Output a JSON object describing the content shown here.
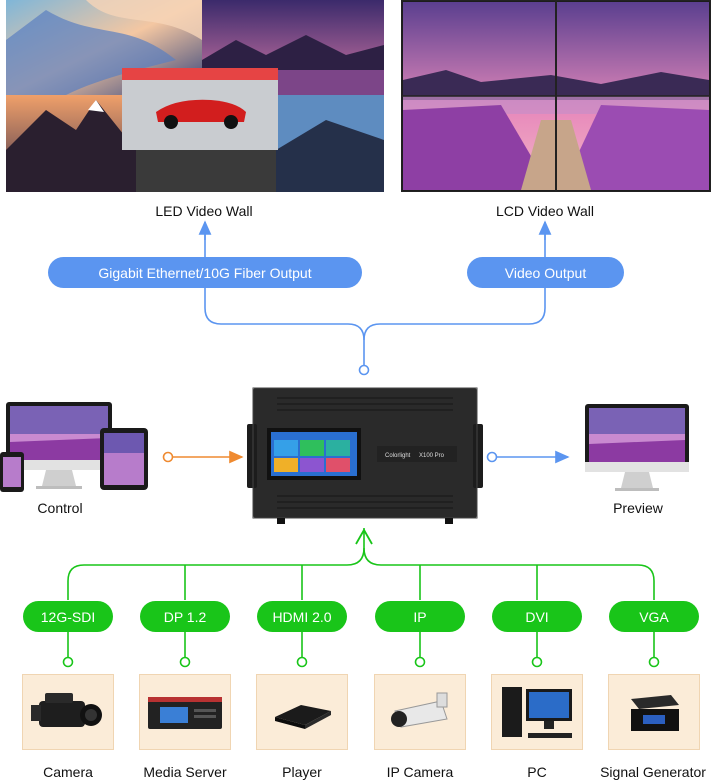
{
  "outputs": {
    "led_label": "LED Video Wall",
    "lcd_label": "LCD Video Wall",
    "gigabit_label": "Gigabit Ethernet/10G Fiber Output",
    "video_output_label": "Video Output"
  },
  "processor": {
    "brand_text": "Colorlight",
    "model_text": "X100 Pro"
  },
  "side_devices": {
    "control_label": "Control",
    "preview_label": "Preview"
  },
  "inputs": [
    {
      "signal": "12G-SDI",
      "device": "Camera"
    },
    {
      "signal": "DP 1.2",
      "device": "Media Server"
    },
    {
      "signal": "HDMI 2.0",
      "device": "Player"
    },
    {
      "signal": "IP",
      "device": "IP Camera"
    },
    {
      "signal": "DVI",
      "device": "PC"
    },
    {
      "signal": "VGA",
      "device": "Signal Generator"
    }
  ],
  "colors": {
    "output_line": "#5b95f0",
    "input_line": "#19c519",
    "control_line": "#ef8a30",
    "device_box": "#fbecd8"
  }
}
